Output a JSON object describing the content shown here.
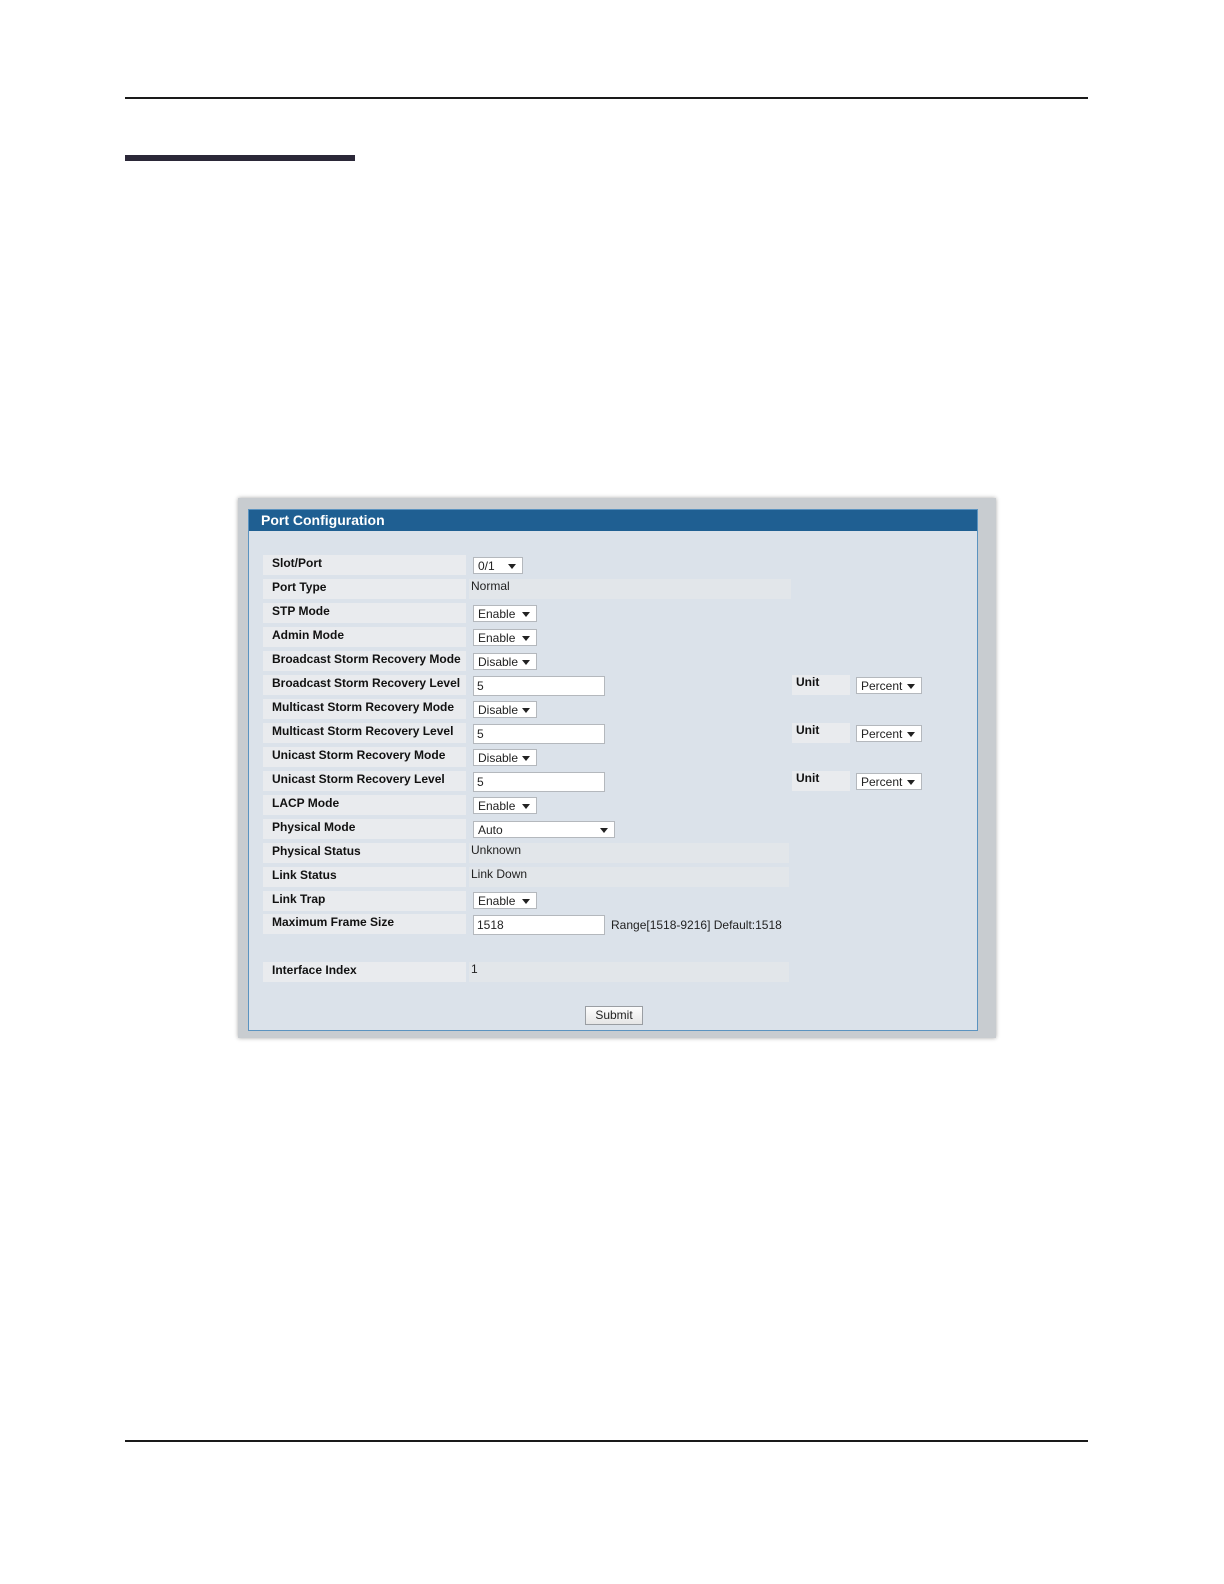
{
  "panel": {
    "title": "Port Configuration"
  },
  "fields": {
    "slot_port": {
      "label": "Slot/Port",
      "value": "0/1"
    },
    "port_type": {
      "label": "Port Type",
      "value": "Normal"
    },
    "stp_mode": {
      "label": "STP Mode",
      "value": "Enable"
    },
    "admin_mode": {
      "label": "Admin Mode",
      "value": "Enable"
    },
    "broadcast_mode": {
      "label": "Broadcast Storm Recovery Mode",
      "value": "Disable"
    },
    "broadcast_level": {
      "label": "Broadcast Storm Recovery Level",
      "value": "5",
      "unit_label": "Unit",
      "unit_value": "Percent"
    },
    "multicast_mode": {
      "label": "Multicast Storm Recovery Mode",
      "value": "Disable"
    },
    "multicast_level": {
      "label": "Multicast Storm Recovery Level",
      "value": "5",
      "unit_label": "Unit",
      "unit_value": "Percent"
    },
    "unicast_mode": {
      "label": "Unicast Storm Recovery Mode",
      "value": "Disable"
    },
    "unicast_level": {
      "label": "Unicast Storm Recovery Level",
      "value": "5",
      "unit_label": "Unit",
      "unit_value": "Percent"
    },
    "lacp_mode": {
      "label": "LACP Mode",
      "value": "Enable"
    },
    "physical_mode": {
      "label": "Physical Mode",
      "value": "Auto"
    },
    "physical_status": {
      "label": "Physical Status",
      "value": "Unknown"
    },
    "link_status": {
      "label": "Link Status",
      "value": "Link Down"
    },
    "link_trap": {
      "label": "Link Trap",
      "value": "Enable"
    },
    "max_frame_size": {
      "label": "Maximum Frame Size",
      "value": "1518",
      "hint": "Range[1518-9216] Default:1518"
    },
    "interface_index": {
      "label": "Interface Index",
      "value": "1"
    }
  },
  "actions": {
    "submit_label": "Submit"
  },
  "colors": {
    "title_bar": "#1f5f92",
    "panel_bg": "#dbe2ea",
    "panel_border": "#5b93c0"
  }
}
